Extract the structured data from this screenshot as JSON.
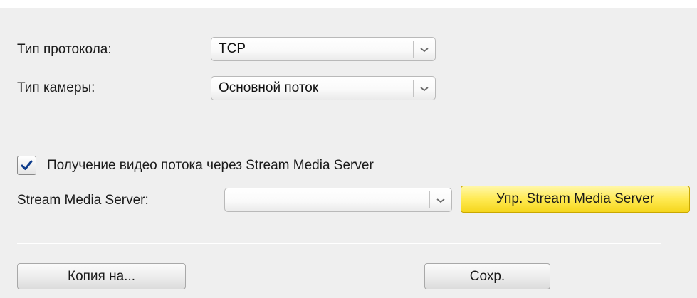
{
  "form": {
    "protocol_label": "Тип протокола:",
    "protocol_value": "TCP",
    "camera_label": "Тип камеры:",
    "camera_value": "Основной поток",
    "sms_checkbox_label": "Получение видео потока через Stream Media Server",
    "sms_checkbox_checked": true,
    "sms_label": "Stream Media Server:",
    "sms_value": "",
    "manage_sms_button": "Упр. Stream Media Server"
  },
  "footer": {
    "copy_button": "Копия на...",
    "save_button": "Сохр."
  },
  "colors": {
    "checkmark": "#0f3d8c",
    "highlight_button": "#ffea52",
    "panel_background": "#efefef"
  },
  "icons": {
    "dropdown": "chevron-down-icon",
    "checkbox": "checkmark-icon"
  }
}
